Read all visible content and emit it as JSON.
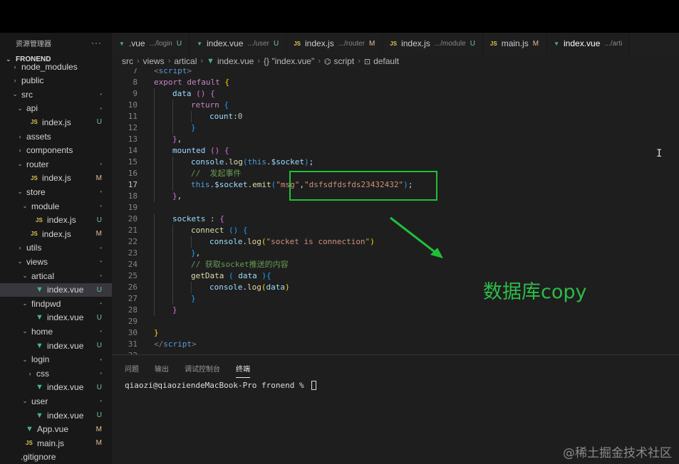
{
  "explorer": {
    "title": "资源管理器",
    "more": "···",
    "root": "FRONEND",
    "items": [
      {
        "label": "node_modules",
        "type": "folder",
        "depth": 1,
        "open": false,
        "status": ""
      },
      {
        "label": "public",
        "type": "folder",
        "depth": 1,
        "open": false,
        "status": ""
      },
      {
        "label": "src",
        "type": "folder",
        "depth": 1,
        "open": true,
        "status": "•"
      },
      {
        "label": "api",
        "type": "folder",
        "depth": 2,
        "open": true,
        "status": "•"
      },
      {
        "label": "index.js",
        "type": "js",
        "depth": 3,
        "status": "U"
      },
      {
        "label": "assets",
        "type": "folder",
        "depth": 2,
        "open": false,
        "status": ""
      },
      {
        "label": "components",
        "type": "folder",
        "depth": 2,
        "open": false,
        "status": ""
      },
      {
        "label": "router",
        "type": "folder",
        "depth": 2,
        "open": true,
        "status": "•"
      },
      {
        "label": "index.js",
        "type": "js",
        "depth": 3,
        "status": "M"
      },
      {
        "label": "store",
        "type": "folder",
        "depth": 2,
        "open": true,
        "status": "•"
      },
      {
        "label": "module",
        "type": "folder",
        "depth": 3,
        "open": true,
        "status": "•"
      },
      {
        "label": "index.js",
        "type": "js",
        "depth": 4,
        "status": "U"
      },
      {
        "label": "index.js",
        "type": "js",
        "depth": 3,
        "status": "M"
      },
      {
        "label": "utils",
        "type": "folder",
        "depth": 2,
        "open": false,
        "status": "•"
      },
      {
        "label": "views",
        "type": "folder",
        "depth": 2,
        "open": true,
        "status": "•"
      },
      {
        "label": "artical",
        "type": "folder",
        "depth": 3,
        "open": true,
        "status": "•"
      },
      {
        "label": "index.vue",
        "type": "vue",
        "depth": 4,
        "status": "U",
        "selected": true
      },
      {
        "label": "findpwd",
        "type": "folder",
        "depth": 3,
        "open": true,
        "status": "•"
      },
      {
        "label": "index.vue",
        "type": "vue",
        "depth": 4,
        "status": "U"
      },
      {
        "label": "home",
        "type": "folder",
        "depth": 3,
        "open": true,
        "status": "•"
      },
      {
        "label": "index.vue",
        "type": "vue",
        "depth": 4,
        "status": "U"
      },
      {
        "label": "login",
        "type": "folder",
        "depth": 3,
        "open": true,
        "status": "•"
      },
      {
        "label": "css",
        "type": "folder",
        "depth": 4,
        "open": false,
        "status": "•"
      },
      {
        "label": "index.vue",
        "type": "vue",
        "depth": 4,
        "status": "U"
      },
      {
        "label": "user",
        "type": "folder",
        "depth": 3,
        "open": true,
        "status": "•"
      },
      {
        "label": "index.vue",
        "type": "vue",
        "depth": 4,
        "status": "U"
      },
      {
        "label": "App.vue",
        "type": "vue",
        "depth": 2,
        "status": "M"
      },
      {
        "label": "main.js",
        "type": "js",
        "depth": 2,
        "status": "M"
      },
      {
        "label": ".gitignore",
        "type": "file",
        "depth": 1,
        "status": ""
      }
    ]
  },
  "tabs": [
    {
      "icon": "vue",
      "label": ".vue",
      "path": ".../login",
      "status": "U",
      "active": false
    },
    {
      "icon": "vue",
      "label": "index.vue",
      "path": ".../user",
      "status": "U",
      "active": false
    },
    {
      "icon": "js",
      "label": "index.js",
      "path": ".../router",
      "status": "M",
      "active": false
    },
    {
      "icon": "js",
      "label": "index.js",
      "path": ".../module",
      "status": "U",
      "active": false
    },
    {
      "icon": "js",
      "label": "main.js",
      "path": "",
      "status": "M",
      "active": false
    },
    {
      "icon": "vue",
      "label": "index.vue",
      "path": ".../arti",
      "status": "",
      "active": true
    }
  ],
  "breadcrumb": {
    "parts": [
      "src",
      "views",
      "artical"
    ],
    "file": "index.vue",
    "obj": "{} \"index.vue\"",
    "script": "script",
    "def": "default"
  },
  "editor": {
    "current_line": 17,
    "lines": [
      {
        "n": 7,
        "indent": 0,
        "tokens": [
          [
            "tag",
            "<"
          ],
          [
            "tagn",
            "script"
          ],
          [
            "tag",
            ">"
          ]
        ]
      },
      {
        "n": 8,
        "indent": 0,
        "tokens": [
          [
            "kw",
            "export"
          ],
          [
            "plain",
            " "
          ],
          [
            "kw",
            "default"
          ],
          [
            "plain",
            " "
          ],
          [
            "brk",
            "{"
          ]
        ]
      },
      {
        "n": 9,
        "indent": 1,
        "tokens": [
          [
            "prop",
            "data"
          ],
          [
            "plain",
            " "
          ],
          [
            "brk2",
            "()"
          ],
          [
            "plain",
            " "
          ],
          [
            "brk2",
            "{"
          ]
        ]
      },
      {
        "n": 10,
        "indent": 2,
        "tokens": [
          [
            "kw",
            "return"
          ],
          [
            "plain",
            " "
          ],
          [
            "brk3",
            "{"
          ]
        ]
      },
      {
        "n": 11,
        "indent": 3,
        "tokens": [
          [
            "prop",
            "count"
          ],
          [
            "plain",
            ":"
          ],
          [
            "num",
            "0"
          ]
        ]
      },
      {
        "n": 12,
        "indent": 2,
        "tokens": [
          [
            "brk3",
            "}"
          ]
        ]
      },
      {
        "n": 13,
        "indent": 1,
        "tokens": [
          [
            "brk2",
            "}"
          ],
          [
            "plain",
            ","
          ]
        ]
      },
      {
        "n": 14,
        "indent": 1,
        "tokens": [
          [
            "prop",
            "mounted"
          ],
          [
            "plain",
            " "
          ],
          [
            "brk2",
            "()"
          ],
          [
            "plain",
            " "
          ],
          [
            "brk2",
            "{"
          ]
        ]
      },
      {
        "n": 15,
        "indent": 2,
        "tokens": [
          [
            "prop",
            "console"
          ],
          [
            "plain",
            "."
          ],
          [
            "fn",
            "log"
          ],
          [
            "brk3",
            "("
          ],
          [
            "thisk",
            "this"
          ],
          [
            "plain",
            "."
          ],
          [
            "prop",
            "$socket"
          ],
          [
            "brk3",
            ")"
          ],
          [
            "plain",
            ";"
          ]
        ]
      },
      {
        "n": 16,
        "indent": 2,
        "tokens": [
          [
            "cmt",
            "//  发起事件"
          ]
        ]
      },
      {
        "n": 17,
        "indent": 2,
        "tokens": [
          [
            "thisk",
            "this"
          ],
          [
            "plain",
            "."
          ],
          [
            "prop",
            "$socket"
          ],
          [
            "plain",
            "."
          ],
          [
            "fn",
            "emit"
          ],
          [
            "brk3",
            "("
          ],
          [
            "str",
            "\"msg\""
          ],
          [
            "plain",
            ","
          ],
          [
            "str",
            "\"dsfsdfdsfds23432432\""
          ],
          [
            "brk3",
            ")"
          ],
          [
            "plain",
            ";"
          ]
        ]
      },
      {
        "n": 18,
        "indent": 1,
        "tokens": [
          [
            "brk2",
            "}"
          ],
          [
            "plain",
            ","
          ]
        ]
      },
      {
        "n": 19,
        "indent": 0,
        "tokens": []
      },
      {
        "n": 20,
        "indent": 1,
        "tokens": [
          [
            "prop",
            "sockets"
          ],
          [
            "plain",
            " : "
          ],
          [
            "brk2",
            "{"
          ]
        ]
      },
      {
        "n": 21,
        "indent": 2,
        "tokens": [
          [
            "fn",
            "connect"
          ],
          [
            "plain",
            " "
          ],
          [
            "brk3",
            "()"
          ],
          [
            "plain",
            " "
          ],
          [
            "brk3",
            "{"
          ]
        ]
      },
      {
        "n": 22,
        "indent": 3,
        "tokens": [
          [
            "prop",
            "console"
          ],
          [
            "plain",
            "."
          ],
          [
            "fn",
            "log"
          ],
          [
            "brk",
            "("
          ],
          [
            "str",
            "\"socket is connection\""
          ],
          [
            "brk",
            ")"
          ]
        ]
      },
      {
        "n": 23,
        "indent": 2,
        "tokens": [
          [
            "brk3",
            "}"
          ],
          [
            "plain",
            ","
          ]
        ]
      },
      {
        "n": 24,
        "indent": 2,
        "tokens": [
          [
            "cmt",
            "// 获取socket推送的内容"
          ]
        ]
      },
      {
        "n": 25,
        "indent": 2,
        "tokens": [
          [
            "fn",
            "getData"
          ],
          [
            "plain",
            " "
          ],
          [
            "brk3",
            "("
          ],
          [
            "plain",
            " "
          ],
          [
            "prop",
            "data"
          ],
          [
            "plain",
            " "
          ],
          [
            "brk3",
            ")"
          ],
          [
            "brk3",
            "{"
          ]
        ]
      },
      {
        "n": 26,
        "indent": 3,
        "tokens": [
          [
            "prop",
            "console"
          ],
          [
            "plain",
            "."
          ],
          [
            "fn",
            "log"
          ],
          [
            "brk",
            "("
          ],
          [
            "prop",
            "data"
          ],
          [
            "brk",
            ")"
          ]
        ]
      },
      {
        "n": 27,
        "indent": 2,
        "tokens": [
          [
            "brk3",
            "}"
          ]
        ]
      },
      {
        "n": 28,
        "indent": 1,
        "tokens": [
          [
            "brk2",
            "}"
          ]
        ]
      },
      {
        "n": 29,
        "indent": 0,
        "tokens": []
      },
      {
        "n": 30,
        "indent": 0,
        "tokens": [
          [
            "brk",
            "}"
          ]
        ]
      },
      {
        "n": 31,
        "indent": 0,
        "tokens": [
          [
            "tag",
            "</"
          ],
          [
            "tagn",
            "script"
          ],
          [
            "tag",
            ">"
          ]
        ]
      },
      {
        "n": 32,
        "indent": 0,
        "tokens": []
      }
    ]
  },
  "annotation": {
    "text": "数据库copy",
    "color": "#2dbb4a"
  },
  "panel": {
    "tabs": [
      "问题",
      "输出",
      "调试控制台",
      "终端"
    ],
    "active_tab": "终端",
    "prompt": "qiaozi@qiaoziendeMacBook-Pro fronend % "
  },
  "watermark": "@稀土掘金技术社区"
}
